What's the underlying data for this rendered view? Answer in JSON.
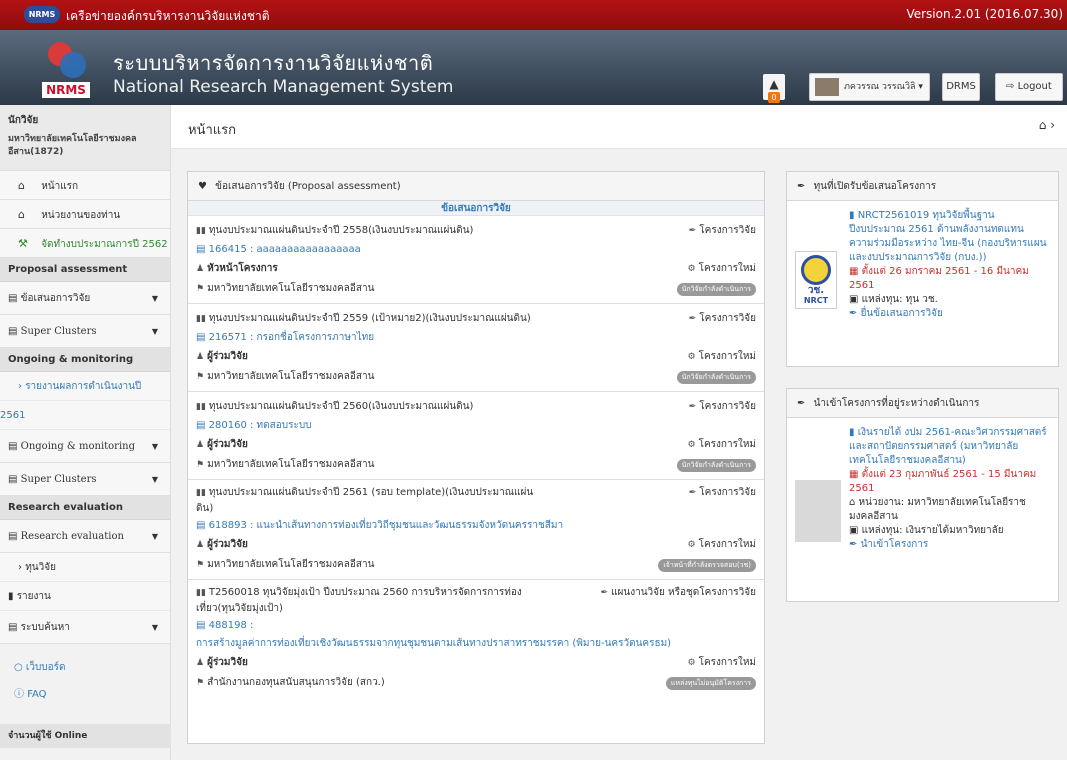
{
  "topbar": {
    "logo_text": "NRMS",
    "network_title": "เครือข่ายองค์กรบริหารงานวิจัยแห่งชาติ",
    "version": "Version.2.01 (2016.07.30)"
  },
  "header": {
    "logo_text": "NRMS",
    "system_name_th": "ระบบบริหารจัดการงานวิจัยแห่งชาติ",
    "system_name_en": "National Research Management System",
    "notification_count": "0",
    "user_name": "ภควรรณ วรรณวิลิ",
    "drms_label": "DRMS",
    "logout_label": "Logout"
  },
  "sidebar": {
    "role": "นักวิจัย",
    "organization": "มหาวิทยาลัยเทคโนโลยีราชมงคลอีสาน(1872)",
    "items": [
      {
        "label": "หน้าแรก",
        "icon": "home-icon"
      },
      {
        "label": "หน่วยงานของท่าน",
        "icon": "home-icon"
      },
      {
        "label": "จัดทำงบประมาณการปี 2562",
        "icon": "hammer-icon"
      }
    ],
    "sections": [
      {
        "title": "Proposal assessment",
        "subs": [
          "ข้อเสนอการวิจัย",
          "Super Clusters"
        ]
      },
      {
        "title": "Ongoing & monitoring",
        "link": "รายงานผลการดำเนินงานปี",
        "year": "2561",
        "subs": [
          "Ongoing & monitoring",
          "Super Clusters"
        ]
      },
      {
        "title": "Research evaluation",
        "subs": [
          "Research evaluation"
        ],
        "plain": [
          "ทุนวิจัย",
          "รายงาน"
        ],
        "search": "ระบบค้นหา"
      }
    ],
    "webboard": "เว็บบอร์ด",
    "faq": "FAQ",
    "online": "จำนวนผู้ใช้ Online"
  },
  "main": {
    "page_title": "หน้าแรก",
    "proposal_panel_title": "ข้อเสนอการวิจัย (Proposal assessment)",
    "proposal_subheader": "ข้อเสนอการวิจัย",
    "proposals": [
      {
        "title": "ทุนงบประมาณแผ่นดินประจำปี 2558(เงินงบประมาณแผ่นดิน)",
        "type": "โครงการวิจัย",
        "code": "166415 : aaaaaaaaaaaaaaaaa",
        "role": "หัวหน้าโครงการ",
        "status": "โครงการใหม่",
        "org": "มหาวิทยาลัยเทคโนโลยีราชมงคลอีสาน",
        "badge": "นักวิจัยกำลังดำเนินการ"
      },
      {
        "title": "ทุนงบประมาณแผ่นดินประจำปี 2559 (เป้าหมาย2)(เงินงบประมาณแผ่นดิน)",
        "type": "โครงการวิจัย",
        "code": "216571 : กรอกชื่อโครงการภาษาไทย",
        "role": "ผู้ร่วมวิจัย",
        "status": "โครงการใหม่",
        "org": "มหาวิทยาลัยเทคโนโลยีราชมงคลอีสาน",
        "badge": "นักวิจัยกำลังดำเนินการ"
      },
      {
        "title": "ทุนงบประมาณแผ่นดินประจำปี 2560(เงินงบประมาณแผ่นดิน)",
        "type": "โครงการวิจัย",
        "code": "280160 : ทดสอบระบบ",
        "role": "ผู้ร่วมวิจัย",
        "status": "โครงการใหม่",
        "org": "มหาวิทยาลัยเทคโนโลยีราชมงคลอีสาน",
        "badge": "นักวิจัยกำลังดำเนินการ"
      },
      {
        "title": "ทุนงบประมาณแผ่นดินประจำปี 2561 (รอบ template)(เงินงบประมาณแผ่นดิน)",
        "type": "โครงการวิจัย",
        "code": "618893 : แนะนำเส้นทางการท่องเที่ยววิถีชุมชนและวัฒนธรรมจังหวัดนครราชสีมา",
        "role": "ผู้ร่วมวิจัย",
        "status": "โครงการใหม่",
        "org": "มหาวิทยาลัยเทคโนโลยีราชมงคลอีสาน",
        "badge": "เจ้าหน้าที่กำลังตรวจสอบ(วช)"
      },
      {
        "title": "T2560018 ทุนวิจัยมุ่งเป้า ปีงบประมาณ 2560 การบริหารจัดการการท่องเที่ยว(ทุนวิจัยมุ่งเป้า)",
        "type": "แผนงานวิจัย หรือชุดโครงการวิจัย",
        "code": "488198 :",
        "code2": "การสร้างมูลค่าการท่องเที่ยวเชิงวัฒนธรรมจากทุนชุมชนตามเส้นทางปราสาทราชมรรคา (พิมาย-นครวัดนครธม)",
        "role": "ผู้ร่วมวิจัย",
        "status": "โครงการใหม่",
        "org": "สำนักงานกองทุนสนับสนุนการวิจัย (สกว.)",
        "badge": "แหล่งทุนไม่อนุมัติโครงการ"
      }
    ]
  },
  "right": {
    "panel1_title": "ทุนที่เปิดรับข้อเสนอโครงการ",
    "panel1": {
      "logo_text1": "วช.",
      "logo_text2": "NRCT",
      "grant": "NRCT2561019 ทุนวิจัยพื้นฐาน ปีงบประมาณ 2561 ด้านพลังงานทดแทน ความร่วมมือระหว่าง ไทย-จีน (กองบริหารแผนและงบประมาณการวิจัย (กบง.))",
      "date": "ตั้งแต่ 26 มกราคม 2561 - 16 มีนาคม 2561",
      "source": "แหล่งทุน: ทุน วช.",
      "action": "ยื่นข้อเสนอการวิจัย"
    },
    "panel2_title": "นำเข้าโครงการที่อยู่ระหว่างดำเนินการ",
    "panel2": {
      "grant": "เงินรายได้ งปม 2561-คณะวิศวกรรมศาสตร์และสถาปัตยกรรมศาสตร์ (มหาวิทยาลัยเทคโนโลยีราชมงคลอีสาน)",
      "date": "ตั้งแต่ 23 กุมภาพันธ์ 2561 - 15 มีนาคม 2561",
      "agency": "หน่วยงาน: มหาวิทยาลัยเทคโนโลยีราชมงคลอีสาน",
      "source": "แหล่งทุน: เงินรายได้มหาวิทยาลัย",
      "action": "นำเข้าโครงการ"
    }
  },
  "colors": {
    "topbar": "#a30f11",
    "link": "#337ab7",
    "date": "#c9302c",
    "green": "#2f8a2f"
  }
}
